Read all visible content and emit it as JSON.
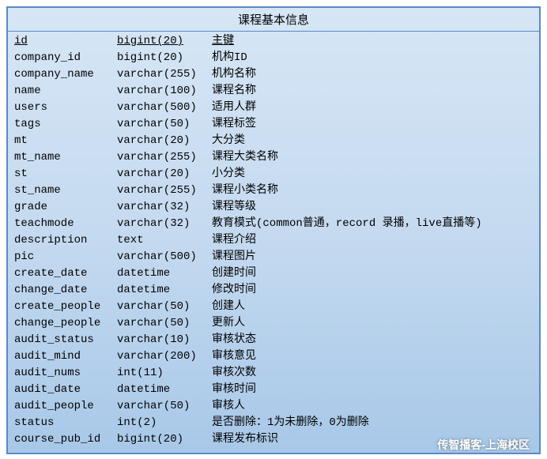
{
  "title": "课程基本信息",
  "watermark": "传智播客-上海校区",
  "columns": [
    {
      "field": "id",
      "type": "bigint(20)",
      "desc": "主键",
      "pk": true
    },
    {
      "field": "company_id",
      "type": "bigint(20)",
      "desc": "机构ID",
      "pk": false
    },
    {
      "field": "company_name",
      "type": "varchar(255)",
      "desc": "机构名称",
      "pk": false
    },
    {
      "field": "name",
      "type": "varchar(100)",
      "desc": "课程名称",
      "pk": false
    },
    {
      "field": "users",
      "type": "varchar(500)",
      "desc": "适用人群",
      "pk": false
    },
    {
      "field": "tags",
      "type": "varchar(50)",
      "desc": "课程标签",
      "pk": false
    },
    {
      "field": "mt",
      "type": "varchar(20)",
      "desc": "大分类",
      "pk": false
    },
    {
      "field": "mt_name",
      "type": "varchar(255)",
      "desc": "课程大类名称",
      "pk": false
    },
    {
      "field": "st",
      "type": "varchar(20)",
      "desc": "小分类",
      "pk": false
    },
    {
      "field": "st_name",
      "type": "varchar(255)",
      "desc": "课程小类名称",
      "pk": false
    },
    {
      "field": "grade",
      "type": "varchar(32)",
      "desc": "课程等级",
      "pk": false
    },
    {
      "field": "teachmode",
      "type": "varchar(32)",
      "desc": "教育模式(common普通，record 录播，live直播等)",
      "pk": false
    },
    {
      "field": "description",
      "type": "text",
      "desc": "课程介绍",
      "pk": false
    },
    {
      "field": "pic",
      "type": "varchar(500)",
      "desc": "课程图片",
      "pk": false
    },
    {
      "field": "create_date",
      "type": "datetime",
      "desc": "创建时间",
      "pk": false
    },
    {
      "field": "change_date",
      "type": "datetime",
      "desc": "修改时间",
      "pk": false
    },
    {
      "field": "create_people",
      "type": "varchar(50)",
      "desc": "创建人",
      "pk": false
    },
    {
      "field": "change_people",
      "type": "varchar(50)",
      "desc": "更新人",
      "pk": false
    },
    {
      "field": "audit_status",
      "type": "varchar(10)",
      "desc": "审核状态",
      "pk": false
    },
    {
      "field": "audit_mind",
      "type": "varchar(200)",
      "desc": "审核意见",
      "pk": false
    },
    {
      "field": "audit_nums",
      "type": "int(11)",
      "desc": "审核次数",
      "pk": false
    },
    {
      "field": "audit_date",
      "type": "datetime",
      "desc": "审核时间",
      "pk": false
    },
    {
      "field": "audit_people",
      "type": "varchar(50)",
      "desc": "审核人",
      "pk": false
    },
    {
      "field": "status",
      "type": "int(2)",
      "desc": "是否删除：1为未删除，0为删除",
      "pk": false
    },
    {
      "field": "course_pub_id",
      "type": "bigint(20)",
      "desc": "课程发布标识",
      "pk": false
    }
  ]
}
